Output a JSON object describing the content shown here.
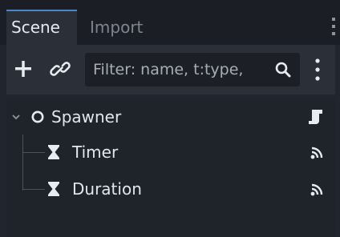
{
  "tabs": [
    {
      "label": "Scene",
      "active": true
    },
    {
      "label": "Import",
      "active": false
    }
  ],
  "toolbar": {
    "filter_placeholder": "Filter: name, t:type, "
  },
  "tree": {
    "nodes": [
      {
        "label": "Spawner",
        "icon": "node-circle-icon",
        "right_icon": "script-icon",
        "expanded": true
      },
      {
        "label": "Timer",
        "icon": "hourglass-icon",
        "right_icon": "signal-icon"
      },
      {
        "label": "Duration",
        "icon": "hourglass-icon",
        "right_icon": "signal-icon"
      }
    ]
  },
  "colors": {
    "accent": "#4a86c8",
    "panel_bg": "#21262e",
    "tree_bg": "#1f242b",
    "text": "#e3e6ea"
  }
}
